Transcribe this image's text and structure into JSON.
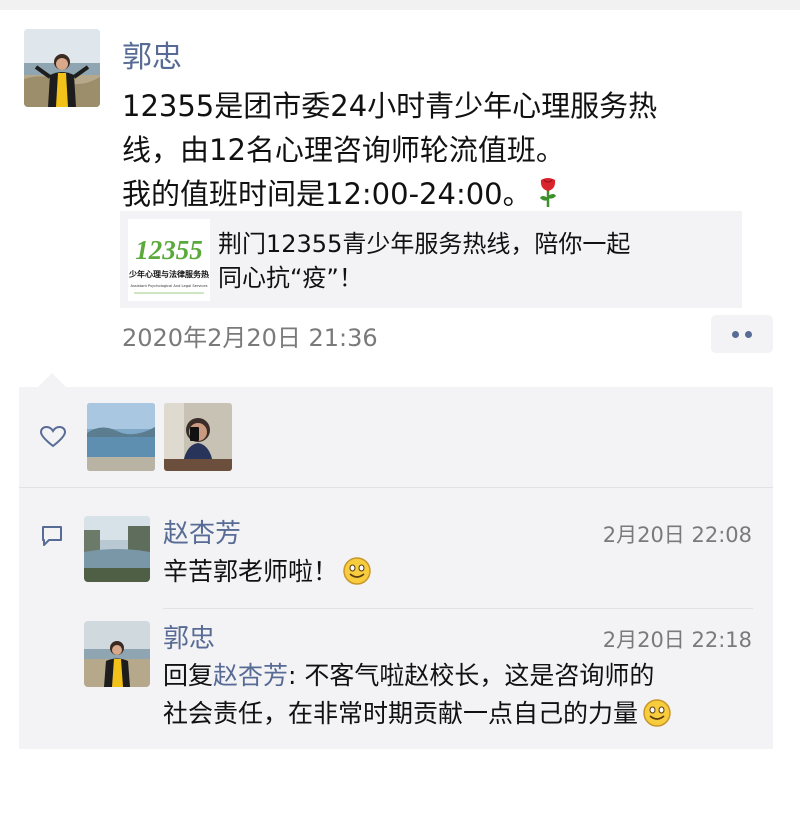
{
  "post": {
    "author": "郭忠",
    "text_lines": [
      "12355是团市委24小时青少年心理服务热",
      "线，由12名心理咨询师轮流值班。",
      "我的值班时间是12:00-24:00。"
    ],
    "text_emoji": "rose-icon",
    "link_card": {
      "thumb_number": "12355",
      "thumb_caption": "少年心理与法律服务热",
      "thumb_caption_small": "Assistant Psychological And Legal Services",
      "title_lines": [
        "荆门12355青少年服务热线，陪你一起",
        "同心抗“疫”！"
      ]
    },
    "timestamp": "2020年2月20日 21:36"
  },
  "likes": {
    "icon": "heart-icon",
    "avatars": [
      "lake-landscape-avatar",
      "person-phone-avatar"
    ]
  },
  "comments": [
    {
      "author": "赵杏芳",
      "time": "2月20日 22:08",
      "text": "辛苦郭老师啦！",
      "emoji": "smile-icon"
    },
    {
      "author": "郭忠",
      "time": "2月20日 22:18",
      "reply_prefix": "回复",
      "reply_to": "赵杏芳",
      "reply_colon": ": 不客气啦赵校长，这是咨询师的",
      "text_line2": "社会责任，在非常时期贡献一点自己的力量",
      "emoji": "smile-icon"
    }
  ],
  "colors": {
    "name_link": "#576b95",
    "panel_bg": "#f3f3f5",
    "secondary_text": "#7a7a7a"
  }
}
